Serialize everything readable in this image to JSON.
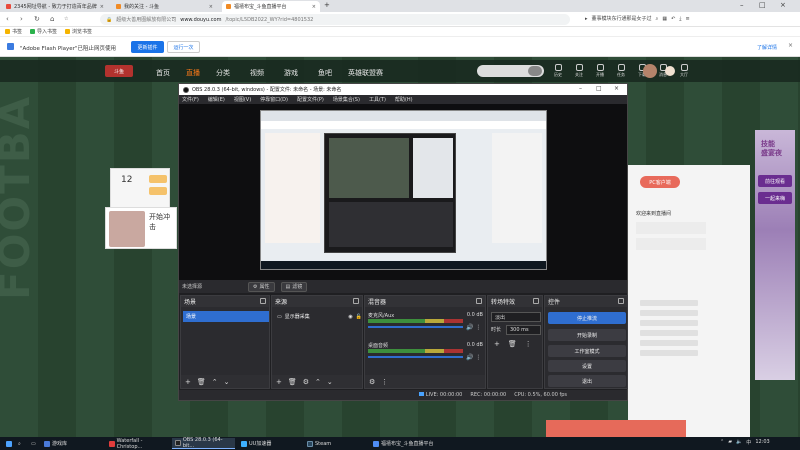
{
  "browser": {
    "tabs": [
      {
        "title": "2345网址导航 - 致力于打造百年品牌",
        "active": false,
        "color": "#e84a3b"
      },
      {
        "title": "我的关注 - 斗鱼",
        "active": false,
        "color": "#f08a24"
      },
      {
        "title": "福禧布宝_斗鱼直播平台",
        "active": true,
        "color": "#f08a24"
      }
    ],
    "url_domain": "www.douyu.com",
    "url_rest": "/topic/L5DB2022_WY?rid=4801532",
    "url_prefix": "超级大善用图解放有限公司",
    "search_hint": "董事模块东行通那是女子过",
    "bookmarks": [
      "书签",
      "导入书签",
      "浏览书签"
    ],
    "flash_msg": "\"Adobe Flash Player\"已阻止网页使用",
    "flash_btn_allow": "更新插件",
    "flash_btn_once": "运行一次",
    "flash_more": "了解详情"
  },
  "douyu": {
    "logo": "斗鱼",
    "nav": [
      "首页",
      "直播",
      "分类",
      "视频",
      "游戏",
      "鱼吧",
      "英雄联盟赛"
    ],
    "nav_active": 1,
    "icons": [
      "历史",
      "关注",
      "开播",
      "任务",
      "下载",
      "消息",
      "大厅"
    ],
    "fans_count": "12",
    "streamer_title": "开始冲击",
    "pc_badge": "PC客户端",
    "right_text": "欢迎来到直播间",
    "side_ad_title": "技能\n盛宴夜",
    "side_ad_btn1": "前往观看",
    "side_ad_btn2": "一起来嗨",
    "watermark": "FOOTBA"
  },
  "obs": {
    "title": "OBS 28.0.3 (64-bit, windows) - 配置文件: 未命名 - 场景: 未命名",
    "menu": [
      "文件(F)",
      "编辑(E)",
      "视图(V)",
      "停靠窗口(D)",
      "配置文件(P)",
      "场景集合(S)",
      "工具(T)",
      "帮助(H)"
    ],
    "source_bar": {
      "label": "未选择源",
      "props": "属性",
      "filters": "滤镜"
    },
    "docks": {
      "scenes": {
        "title": "场景",
        "items": [
          "场景"
        ]
      },
      "sources": {
        "title": "来源",
        "items": [
          "显示器采集"
        ]
      },
      "mixer": {
        "title": "混音器",
        "rows": [
          {
            "name": "麦克风/Aux",
            "db": "0.0 dB"
          },
          {
            "name": "桌面音频",
            "db": "0.0 dB"
          }
        ]
      },
      "transitions": {
        "title": "转场特效",
        "type": "淡出",
        "duration_label": "时长",
        "duration": "300 ms"
      },
      "controls": {
        "title": "控件",
        "buttons": [
          "停止推流",
          "开始录制",
          "工作室模式",
          "设置",
          "退出"
        ]
      }
    },
    "status": {
      "live": "LIVE: 00:00:00",
      "rec": "REC: 00:00:00",
      "cpu": "CPU: 0.5%, 60.00 fps"
    }
  },
  "taskbar": {
    "items": [
      {
        "label": "游戏库",
        "active": false,
        "color": "#4a7ad8"
      },
      {
        "label": "Waterfall - Christop...",
        "active": false,
        "color": "#e03c3c"
      },
      {
        "label": "OBS 28.0.3 (64-bit...",
        "active": true,
        "color": "#222"
      },
      {
        "label": "UU加速器",
        "active": false,
        "color": "#3db0ff"
      },
      {
        "label": "Steam",
        "active": false,
        "color": "#2a475e"
      },
      {
        "label": "福禧布宝_斗鱼直播平台",
        "active": false,
        "color": "#4f8df5"
      }
    ],
    "clock": "12:03"
  }
}
